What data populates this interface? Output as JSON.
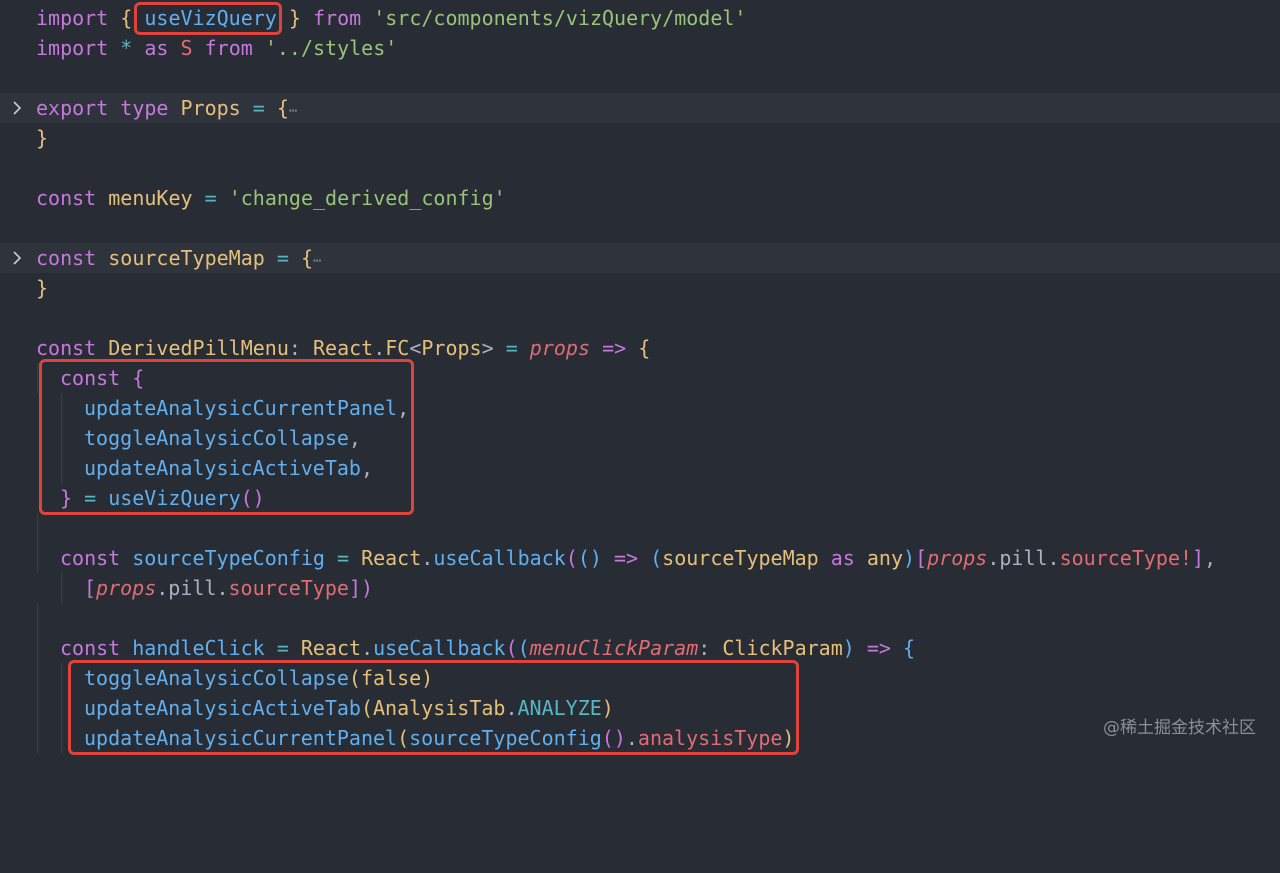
{
  "editor": {
    "lines": {
      "l1": {
        "a": "import",
        "b": "{",
        "c": "useVizQuery",
        "d": "}",
        "e": "from",
        "f": "'src/components/vizQuery/model'"
      },
      "l2": {
        "a": "import",
        "b": "*",
        "c": "as",
        "d": "S",
        "e": "from",
        "f": "'../styles'"
      },
      "l4": {
        "a": "export",
        "b": "type",
        "c": "Props",
        "d": "=",
        "e": "{",
        "f": "⋯"
      },
      "l5": {
        "a": "}"
      },
      "l7": {
        "a": "const",
        "b": "menuKey",
        "c": "=",
        "d": "'change_derived_config'"
      },
      "l9": {
        "a": "const",
        "b": "sourceTypeMap",
        "c": "=",
        "d": "{",
        "e": "⋯"
      },
      "l10": {
        "a": "}"
      },
      "l12": {
        "a": "const",
        "b": "DerivedPillMenu",
        "c": ":",
        "d": "React",
        "e": ".",
        "f": "FC",
        "g": "<",
        "h": "Props",
        "i": ">",
        "j": "=",
        "k": "props",
        "l": "=>",
        "m": "{"
      },
      "l13": {
        "a": "const",
        "b": "{"
      },
      "l14": {
        "a": "updateAnalysicCurrentPanel",
        "b": ","
      },
      "l15": {
        "a": "toggleAnalysicCollapse",
        "b": ","
      },
      "l16": {
        "a": "updateAnalysicActiveTab",
        "b": ","
      },
      "l17": {
        "a": "}",
        "b": "=",
        "c": "useVizQuery",
        "d": "()"
      },
      "l19": {
        "a": "const",
        "b": "sourceTypeConfig",
        "c": "=",
        "d": "React",
        "e": ".",
        "f": "useCallback",
        "g": "(",
        "h": "()",
        "i": "=>",
        "j": "(",
        "k": "sourceTypeMap",
        "l": "as",
        "m": "any",
        "n": ")",
        "o": "[",
        "p": "props",
        "q": ".pill.",
        "r": "sourceType!",
        "s": "]",
        "t": ","
      },
      "l20": {
        "a": "[",
        "b": "props",
        "c": ".pill.",
        "d": "sourceType",
        "e": "]",
        "f": ")"
      },
      "l22": {
        "a": "const",
        "b": "handleClick",
        "c": "=",
        "d": "React",
        "e": ".",
        "f": "useCallback",
        "g": "(",
        "h": "(",
        "i": "menuClickParam",
        "j": ":",
        "k": "ClickParam",
        "l": ")",
        "m": "=>",
        "n": "{"
      },
      "l23": {
        "a": "toggleAnalysicCollapse",
        "b": "(",
        "c": "false",
        "d": ")"
      },
      "l24": {
        "a": "updateAnalysicActiveTab",
        "b": "(",
        "c": "AnalysisTab",
        "d": ".",
        "e": "ANALYZE",
        "f": ")"
      },
      "l25": {
        "a": "updateAnalysicCurrentPanel",
        "b": "(",
        "c": "sourceTypeConfig",
        "d": "()",
        "e": ".",
        "f": "analysisType",
        "g": ")"
      }
    }
  },
  "watermark": "@稀土掘金技术社区",
  "colors": {
    "background": "#282c34",
    "keyword": "#c678dd",
    "string": "#98c379",
    "function": "#61afef",
    "type": "#e5c07b",
    "highlight_box": "#e0433c"
  },
  "icons": {
    "fold": "chevron-right-icon"
  }
}
